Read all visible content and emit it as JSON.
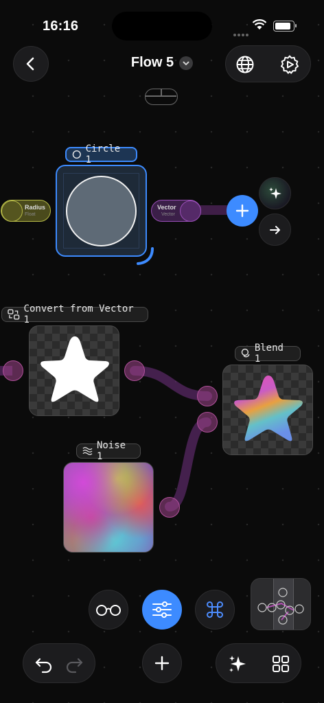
{
  "status_bar": {
    "time": "16:16"
  },
  "header": {
    "title": "Flow 5"
  },
  "nodes": {
    "circle": {
      "label": "Circle 1",
      "input": {
        "name": "Radius",
        "type": "Float"
      },
      "output": {
        "name": "Vector",
        "type": "Vector"
      }
    },
    "convert": {
      "label": "Convert from Vector 1"
    },
    "blend": {
      "label": "Blend 1"
    },
    "noise": {
      "label": "Noise 1"
    }
  },
  "icons": {
    "back": "chevron-left-icon",
    "title_menu": "chevron-down-icon",
    "globe": "globe-icon",
    "settings": "gear-play-icon",
    "ai": "sparkles-icon",
    "next": "arrow-right-icon",
    "add": "plus-icon",
    "preview": "glasses-icon",
    "params": "sliders-icon",
    "shortcuts": "command-icon",
    "undo": "undo-icon",
    "redo": "redo-icon",
    "grid": "grid-icon"
  },
  "colors": {
    "accent": "#3d8bff",
    "circle_node": "#2f7de0",
    "float_port": "#d8dc5a",
    "vector_port": "#a857c4",
    "canvas": "#0b0b0b"
  }
}
